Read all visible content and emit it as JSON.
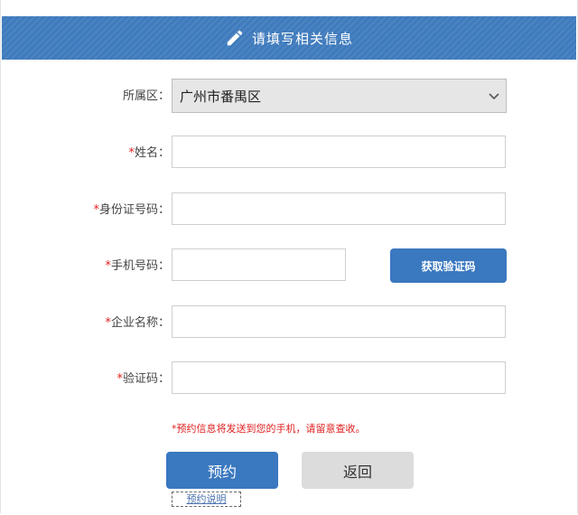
{
  "header": {
    "title": "请填写相关信息",
    "icon": "pencil-icon"
  },
  "form": {
    "district": {
      "label": "所属区：",
      "value": "广州市番禺区"
    },
    "name": {
      "required_mark": "*",
      "label": "姓名：",
      "value": ""
    },
    "id_number": {
      "required_mark": "*",
      "label": "身份证号码：",
      "value": ""
    },
    "phone": {
      "required_mark": "*",
      "label": "手机号码：",
      "value": ""
    },
    "get_code_button": "获取验证码",
    "company": {
      "required_mark": "*",
      "label": "企业名称：",
      "value": ""
    },
    "verify_code": {
      "required_mark": "*",
      "label": "验证码：",
      "value": ""
    }
  },
  "notice": "*预约信息将发送到您的手机，请留意查收。",
  "actions": {
    "submit": "预约",
    "back": "返回",
    "help_link": "预约说明"
  },
  "colors": {
    "primary": "#3a78bf",
    "required": "#e02020",
    "header": "#3f7bbd"
  }
}
